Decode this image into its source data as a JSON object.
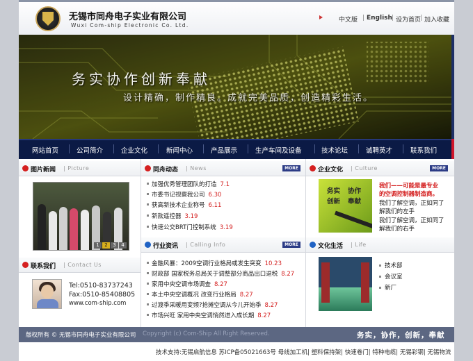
{
  "header": {
    "company_cn": "无锡市同舟电子实业有限公司",
    "company_en": "Wuxi Com-ship Electronic Co. Ltd.",
    "links": [
      "中文版",
      "English",
      "设为首页",
      "加入收藏"
    ]
  },
  "banner": {
    "slogan_main": "务实协作创新奉献",
    "slogan_sub": "设计精确，制作精良。成就完美品质，创造精彩生活。"
  },
  "nav": [
    "网站首页",
    "公司简介",
    "企业文化",
    "新闻中心",
    "产品展示",
    "生产车间及设备",
    "技术论坛",
    "诚聘英才",
    "联系我们"
  ],
  "photo_news": {
    "title": "图片新闻",
    "subtitle": "Picture",
    "pages": [
      "1",
      "2",
      "3",
      "4"
    ]
  },
  "contact": {
    "title": "联系我们",
    "subtitle": "Contact Us",
    "tel": "Tel:0510-83737243",
    "fax": "Fax:0510-85408805",
    "web": "www.com-ship.com"
  },
  "news": {
    "title": "同舟动态",
    "subtitle": "News",
    "more": "MORE",
    "items": [
      {
        "text": "加强优秀管理团队的打造",
        "date": "7.1"
      },
      {
        "text": "市委书记视察我公司",
        "date": "6.30"
      },
      {
        "text": "获高新技术企业称号",
        "date": "6.11"
      },
      {
        "text": "新款遥控器",
        "date": "3.19"
      },
      {
        "text": "快速公交BRT门控制系统",
        "date": "3.19"
      }
    ]
  },
  "industry": {
    "title": "行业资讯",
    "subtitle": "Calling Info",
    "more": "MORE",
    "items": [
      {
        "text": "金融风暴：2009空调行业格局或发生突变",
        "date": "10.23"
      },
      {
        "text": "财政部 国家税务总局关于调整部分商品出口退税",
        "date": "8.27"
      },
      {
        "text": "家用中央空调市场调查",
        "date": "8.27"
      },
      {
        "text": "本土中央空调概况 改变行业格局",
        "date": "8.27"
      },
      {
        "text": "过渡季采暖用变频?抢摊空调从今儿开始季",
        "date": "8.27"
      },
      {
        "text": "市场兴旺 家用中央空调悄然进入成长期",
        "date": "8.27"
      }
    ]
  },
  "culture": {
    "title": "企业文化",
    "subtitle": "Culture",
    "more": "MORE",
    "image_words": [
      "务实",
      "协作",
      "创新",
      "奉献"
    ],
    "lines": [
      {
        "text": "我们——可能是最专业",
        "red": true
      },
      {
        "text": "的空调控制器制造商。",
        "red": true
      },
      {
        "text": "我们了解空调，正如同了",
        "red": false
      },
      {
        "text": "解我们的左手",
        "red": false
      },
      {
        "text": "我们了解空调，正如同了",
        "red": false
      },
      {
        "text": "解我们的右手",
        "red": false
      }
    ]
  },
  "life": {
    "title": "文化生活",
    "subtitle": "Life",
    "items": [
      "技术部",
      "会议室",
      "新厂"
    ]
  },
  "footer": {
    "left": "版权所有  ©  无锡市同舟电子实业有限公司",
    "middle": "Copyright (c) Com-Ship All Right Reserved.",
    "right": "务实，协作，创新，奉献"
  },
  "bottom": {
    "text": "技术支持:无锡启航信息   苏ICP备05021663号 母线加工机| 塑料保持架| 快速卷门| 特种电缆| 无锡彩钢| 无锡物流"
  },
  "colors": {
    "nav_bg": "#0b1a45",
    "accent_red": "#d42020",
    "more_badge": "#2c3c86",
    "footer_bg": "#5c6782"
  }
}
